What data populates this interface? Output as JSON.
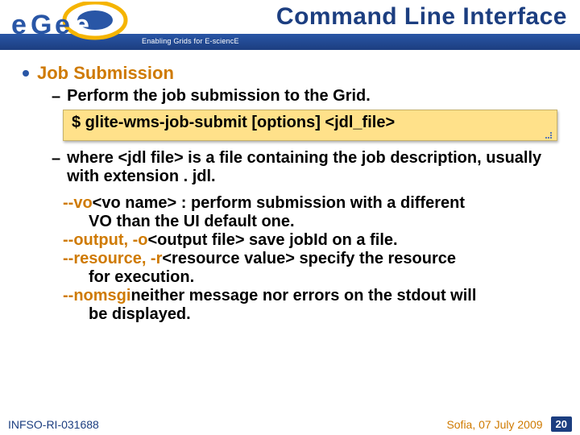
{
  "header": {
    "title": "Command Line Interface",
    "tagline": "Enabling Grids for E-sciencE",
    "logo_text": "eGee"
  },
  "bullet1_label": "Job Submission",
  "sub1_text": "Perform the job submission to the Grid.",
  "command_text": "$ glite-wms-job-submit  [options] <jdl_file>",
  "sub2_text": "where <jdl file> is a file containing the job description, usually with extension . jdl.",
  "options": [
    {
      "flag": "--vo",
      "desc": "  <vo name> : perform submission with a different",
      "cont": "VO than the UI default one."
    },
    {
      "flag": "--output, -o",
      "desc": "  <output file> save jobId on a file.",
      "cont": ""
    },
    {
      "flag": "--resource, -r",
      "desc": "   <resource value> specify the resource",
      "cont": "for execution."
    },
    {
      "flag": "--nomsgi",
      "desc": " neither message nor errors on the stdout will",
      "cont": "be displayed."
    }
  ],
  "footer": {
    "left": "INFSO-RI-031688",
    "location": "Sofia, 07 July 2009",
    "page": "20"
  }
}
